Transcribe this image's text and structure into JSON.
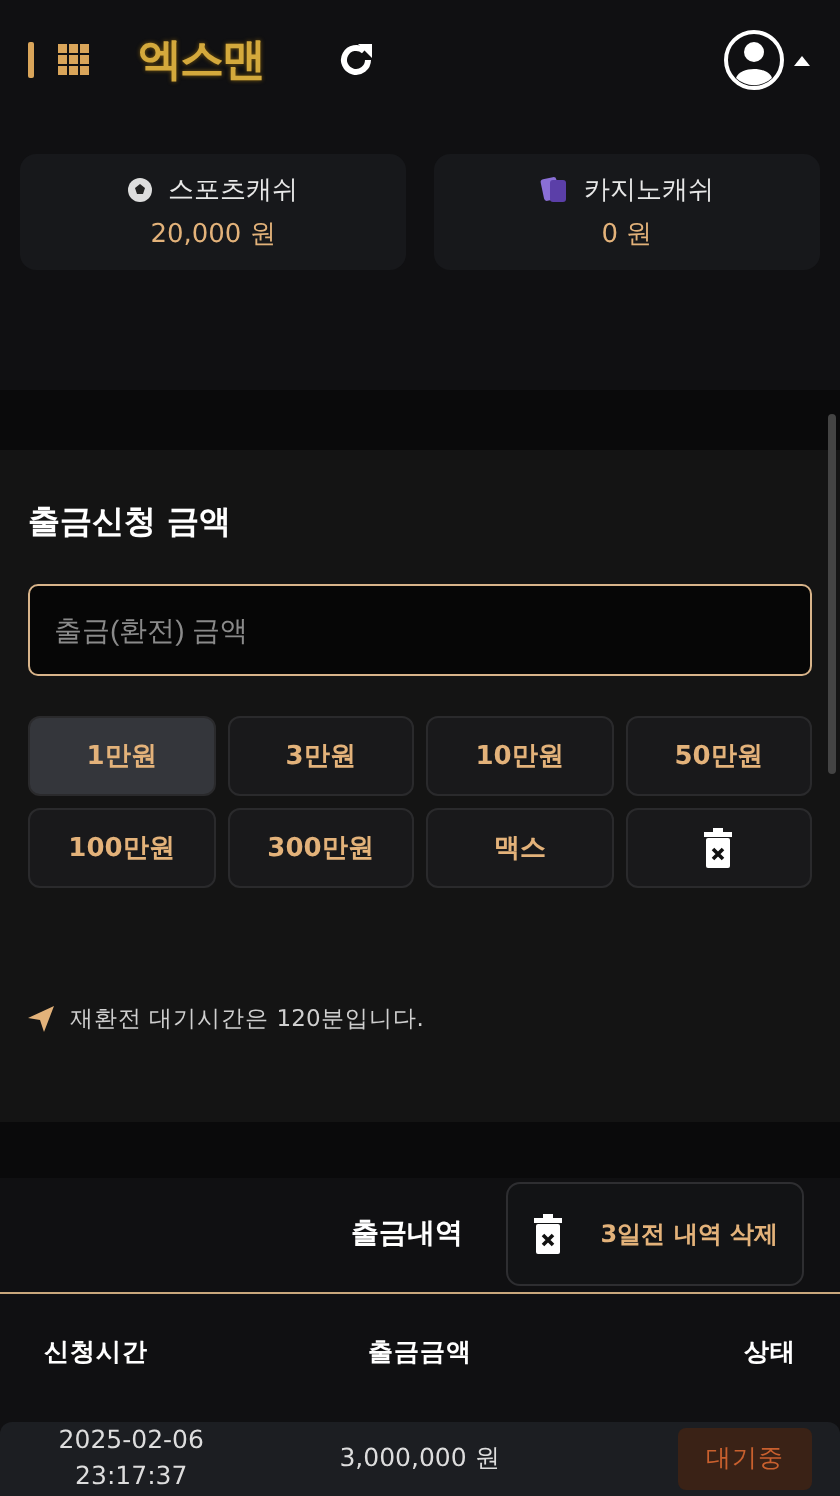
{
  "header": {
    "logo": "엑스맨"
  },
  "wallets": [
    {
      "kind": "sports",
      "label": "스포츠캐쉬",
      "amount": "20,000 원"
    },
    {
      "kind": "casino",
      "label": "카지노캐쉬",
      "amount": "0 원"
    }
  ],
  "withdraw": {
    "title": "출금신청 금액",
    "input": {
      "placeholder": "출금(환전) 금액"
    },
    "quick_buttons": [
      {
        "kind": "amount",
        "label": "1만원",
        "selected": true
      },
      {
        "kind": "amount",
        "label": "3만원",
        "selected": false
      },
      {
        "kind": "amount",
        "label": "10만원",
        "selected": false
      },
      {
        "kind": "amount",
        "label": "50만원",
        "selected": false
      },
      {
        "kind": "amount",
        "label": "100만원",
        "selected": false
      },
      {
        "kind": "amount",
        "label": "300만원",
        "selected": false
      },
      {
        "kind": "amount",
        "label": "맥스",
        "selected": false
      },
      {
        "kind": "clear",
        "selected": false
      }
    ],
    "notice": "재환전 대기시간은 120분입니다."
  },
  "history": {
    "title": "출금내역",
    "delete_button": "3일전 내역 삭제",
    "columns": [
      "신청시간",
      "출금금액",
      "상태"
    ],
    "rows": [
      {
        "date": "2025-02-06",
        "time": "23:17:37",
        "amount": "3,000,000 원",
        "status": "대기중"
      }
    ]
  }
}
